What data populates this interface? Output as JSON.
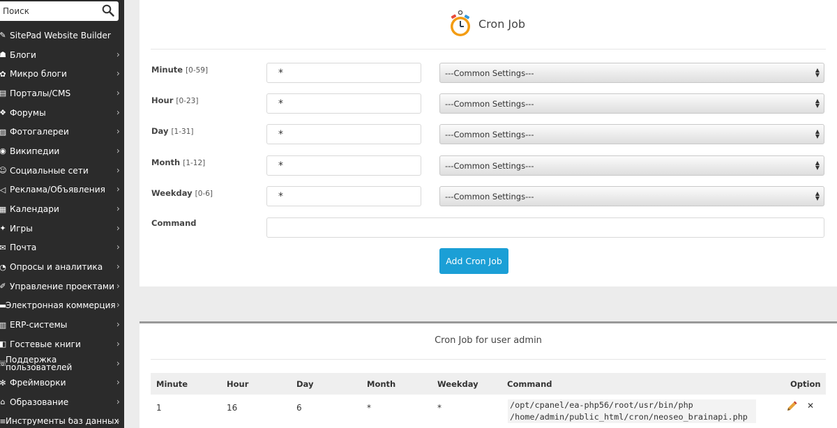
{
  "sidebar": {
    "search_placeholder": "Поиск",
    "items": [
      {
        "label": "SitePad Website Builder",
        "icon": "sitepad-icon",
        "chevron": false
      },
      {
        "label": "Блоги",
        "icon": "blog-icon",
        "chevron": true
      },
      {
        "label": "Микро блоги",
        "icon": "microblog-icon",
        "chevron": true
      },
      {
        "label": "Порталы/CMS",
        "icon": "portal-icon",
        "chevron": true
      },
      {
        "label": "Форумы",
        "icon": "forum-icon",
        "chevron": true
      },
      {
        "label": "Фотогалереи",
        "icon": "photo-gallery-icon",
        "chevron": true
      },
      {
        "label": "Википедии",
        "icon": "wiki-icon",
        "chevron": true
      },
      {
        "label": "Социальные сети",
        "icon": "social-icon",
        "chevron": true
      },
      {
        "label": "Реклама/Объявления",
        "icon": "ads-icon",
        "chevron": true
      },
      {
        "label": "Календари",
        "icon": "calendar-icon",
        "chevron": true
      },
      {
        "label": "Игры",
        "icon": "games-icon",
        "chevron": true
      },
      {
        "label": "Почта",
        "icon": "mail-icon",
        "chevron": true
      },
      {
        "label": "Опросы и аналитика",
        "icon": "polls-icon",
        "chevron": true
      },
      {
        "label": "Управление проектами",
        "icon": "project-icon",
        "chevron": true
      },
      {
        "label": "Электронная коммерция",
        "icon": "ecommerce-icon",
        "chevron": true
      },
      {
        "label": "ERP-системы",
        "icon": "erp-icon",
        "chevron": true
      },
      {
        "label": "Гостевые книги",
        "icon": "guestbook-icon",
        "chevron": true
      },
      {
        "label": "Поддержка пользователей",
        "icon": "support-icon",
        "chevron": true
      },
      {
        "label": "Фреймворки",
        "icon": "framework-icon",
        "chevron": true
      },
      {
        "label": "Образование",
        "icon": "education-icon",
        "chevron": true
      },
      {
        "label": "Инструменты баз данных",
        "icon": "database-icon",
        "chevron": true
      }
    ]
  },
  "cron_form": {
    "title": "Cron Job",
    "fields": [
      {
        "label": "Minute",
        "range": "[0-59]",
        "value": "*",
        "select": "---Common Settings---"
      },
      {
        "label": "Hour",
        "range": "[0-23]",
        "value": "*",
        "select": "---Common Settings---"
      },
      {
        "label": "Day",
        "range": "[1-31]",
        "value": "*",
        "select": "---Common Settings---"
      },
      {
        "label": "Month",
        "range": "[1-12]",
        "value": "*",
        "select": "---Common Settings---"
      },
      {
        "label": "Weekday",
        "range": "[0-6]",
        "value": "*",
        "select": "---Common Settings---"
      }
    ],
    "command_label": "Command",
    "command_value": "",
    "add_button": "Add Cron Job"
  },
  "jobs": {
    "title": "Cron Job for user admin",
    "columns": [
      "Minute",
      "Hour",
      "Day",
      "Month",
      "Weekday",
      "Command",
      "Option"
    ],
    "rows": [
      {
        "minute": "1",
        "hour": "16",
        "day": "6",
        "month": "*",
        "weekday": "*",
        "command_line1": "/opt/cpanel/ea-php56/root/usr/bin/php",
        "command_line2": "/home/admin/public_html/cron/neoseo_brainapi.php"
      }
    ]
  },
  "colors": {
    "sidebar_bg": "#2b2b2b",
    "accent_button": "#1b9fd6",
    "delete_icon": "#d03a2a",
    "edit_icon": "#e8a23a",
    "timer_orange": "#f39c12"
  }
}
